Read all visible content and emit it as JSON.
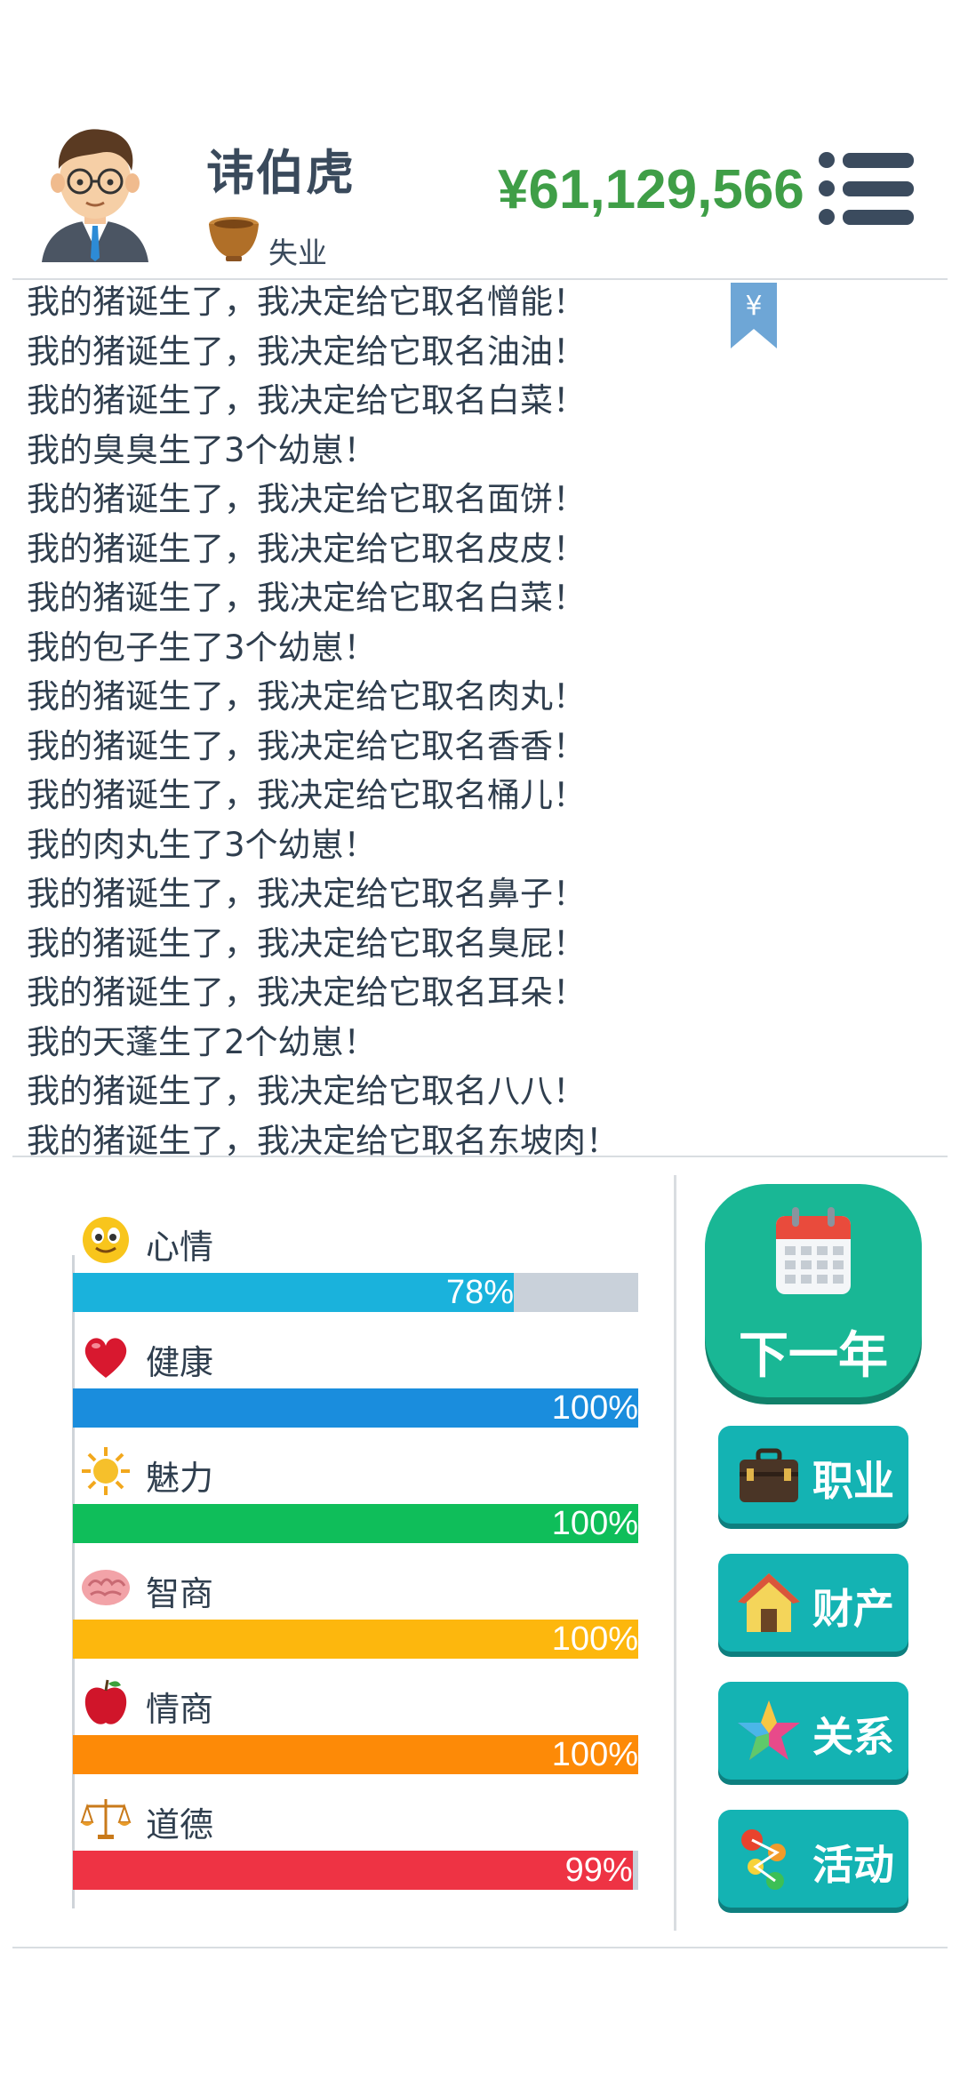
{
  "player": {
    "name": "讳伯虎",
    "job": "失业",
    "money": "¥61,129,566"
  },
  "icons": {
    "avatar": "man-avatar-icon",
    "job": "bowl-icon",
    "menu": "hamburger-menu-icon",
    "bookmark": "yuan-bookmark-icon"
  },
  "bookmark_symbol": "¥",
  "log": [
    "我的猪诞生了，我决定给它取名憎能！",
    "我的猪诞生了，我决定给它取名油油！",
    "我的猪诞生了，我决定给它取名白菜！",
    "我的臭臭生了3个幼崽！",
    "我的猪诞生了，我决定给它取名面饼！",
    "我的猪诞生了，我决定给它取名皮皮！",
    "我的猪诞生了，我决定给它取名白菜！",
    "我的包子生了3个幼崽！",
    "我的猪诞生了，我决定给它取名肉丸！",
    "我的猪诞生了，我决定给它取名香香！",
    "我的猪诞生了，我决定给它取名桶儿！",
    "我的肉丸生了3个幼崽！",
    "我的猪诞生了，我决定给它取名鼻子！",
    "我的猪诞生了，我决定给它取名臭屁！",
    "我的猪诞生了，我决定给它取名耳朵！",
    "我的天蓬生了2个幼崽！",
    "我的猪诞生了，我决定给它取名八八！",
    "我的猪诞生了，我决定给它取名东坡肉！"
  ],
  "stats": [
    {
      "key": "mood",
      "label": "心情",
      "value": 78,
      "text": "78%",
      "color": "#1ab2dc",
      "icon": "smiley-face-icon"
    },
    {
      "key": "health",
      "label": "健康",
      "value": 100,
      "text": "100%",
      "color": "#1a8ddd",
      "icon": "heart-icon"
    },
    {
      "key": "charm",
      "label": "魅力",
      "value": 100,
      "text": "100%",
      "color": "#0fbe5a",
      "icon": "sun-icon"
    },
    {
      "key": "iq",
      "label": "智商",
      "value": 100,
      "text": "100%",
      "color": "#fdb70d",
      "icon": "brain-icon"
    },
    {
      "key": "eq",
      "label": "情商",
      "value": 100,
      "text": "100%",
      "color": "#fd8a07",
      "icon": "apple-icon"
    },
    {
      "key": "morality",
      "label": "道德",
      "value": 99,
      "text": "99%",
      "color": "#ee3344",
      "icon": "scales-icon"
    }
  ],
  "buttons": {
    "next_year": "下一年",
    "career": "职业",
    "assets": "财产",
    "relations": "关系",
    "activities": "活动"
  },
  "colors": {
    "money": "#3f9e47",
    "button_teal": "#14b3b3",
    "next_year_green": "#19b795",
    "track": "#c9d1da",
    "text": "#2f3e4e"
  }
}
